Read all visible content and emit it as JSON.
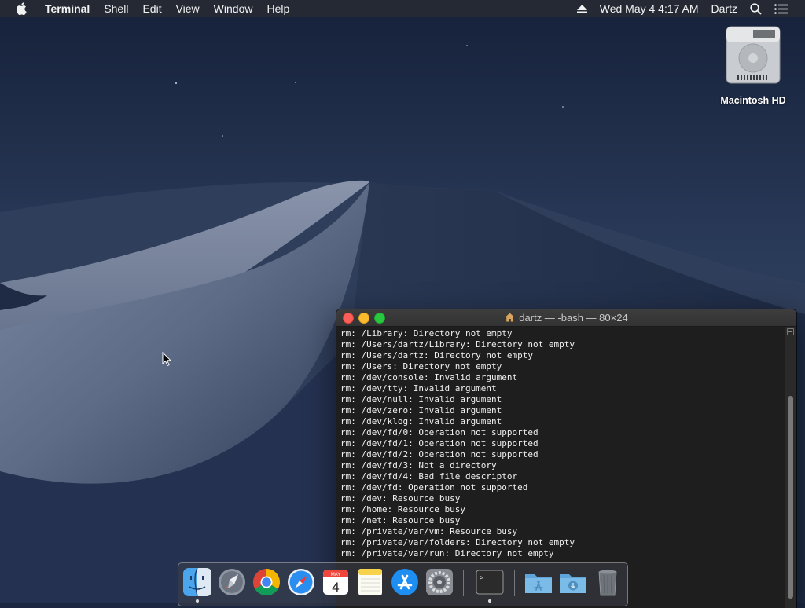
{
  "menubar": {
    "app_name": "Terminal",
    "menus": [
      "Shell",
      "Edit",
      "View",
      "Window",
      "Help"
    ],
    "clock": "Wed May 4  4:17 AM",
    "user": "Dartz",
    "icons": [
      "apple-logo-icon",
      "eject-icon",
      "spotlight-search-icon",
      "notification-center-icon"
    ]
  },
  "desktop": {
    "hd_label": "Macintosh HD"
  },
  "terminal": {
    "title": "dartz — -bash — 80×24",
    "lines": [
      "rm: /Library: Directory not empty",
      "rm: /Users/dartz/Library: Directory not empty",
      "rm: /Users/dartz: Directory not empty",
      "rm: /Users: Directory not empty",
      "rm: /dev/console: Invalid argument",
      "rm: /dev/tty: Invalid argument",
      "rm: /dev/null: Invalid argument",
      "rm: /dev/zero: Invalid argument",
      "rm: /dev/klog: Invalid argument",
      "rm: /dev/fd/0: Operation not supported",
      "rm: /dev/fd/1: Operation not supported",
      "rm: /dev/fd/2: Operation not supported",
      "rm: /dev/fd/3: Not a directory",
      "rm: /dev/fd/4: Bad file descriptor",
      "rm: /dev/fd: Operation not supported",
      "rm: /dev: Resource busy",
      "rm: /home: Resource busy",
      "rm: /net: Resource busy",
      "rm: /private/var/vm: Resource busy",
      "rm: /private/var/folders: Directory not empty",
      "rm: /private/var/run: Directory not empty"
    ]
  },
  "dock": {
    "items": [
      "finder-icon",
      "launchpad-icon",
      "chrome-icon",
      "safari-icon",
      "calendar-icon",
      "notes-icon",
      "app-store-icon",
      "system-preferences-icon",
      "terminal-icon",
      "applications-folder-icon",
      "downloads-folder-icon",
      "trash-icon"
    ],
    "calendar_month": "MAY",
    "calendar_day": "4",
    "terminal_prompt": ">_"
  },
  "colors": {
    "close": "#fc5f57",
    "minimize": "#fdbc2e",
    "maximize": "#28c840",
    "terminal_bg": "#1e1e1e"
  }
}
